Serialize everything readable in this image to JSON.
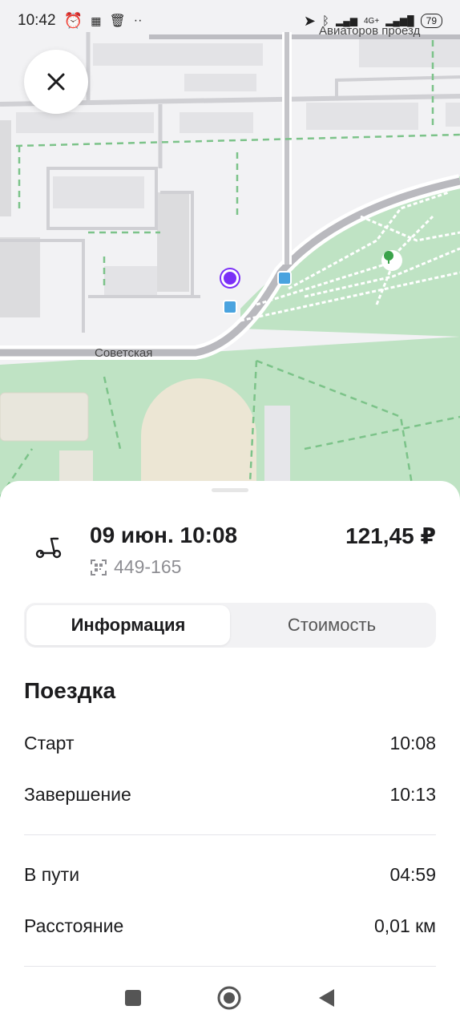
{
  "status_bar": {
    "time": "10:42",
    "network": "4G+",
    "battery": "79"
  },
  "map": {
    "street_top": "Авиаторов проезд",
    "street_main": "Советская"
  },
  "icons": {
    "close": "close-icon",
    "scooter": "scooter-icon",
    "qr": "qr-code-icon",
    "bus_stop": "bus-stop-icon",
    "park": "park-tree-icon",
    "location": "location-pin-icon"
  },
  "trip": {
    "date_time": "09 июн. 10:08",
    "price": "121,45 ₽",
    "scooter_id": "449-165"
  },
  "tabs": [
    {
      "label": "Информация",
      "active": true
    },
    {
      "label": "Стоимость",
      "active": false
    }
  ],
  "section": {
    "title": "Поездка",
    "rows": [
      {
        "label": "Старт",
        "value": "10:08"
      },
      {
        "label": "Завершение",
        "value": "10:13"
      },
      {
        "label": "В пути",
        "value": "04:59"
      },
      {
        "label": "Расстояние",
        "value": "0,01 км"
      }
    ]
  },
  "colors": {
    "accent_purple": "#7b2ff7",
    "park_green": "#b9dfbf",
    "bus_blue": "#4aa3df"
  }
}
